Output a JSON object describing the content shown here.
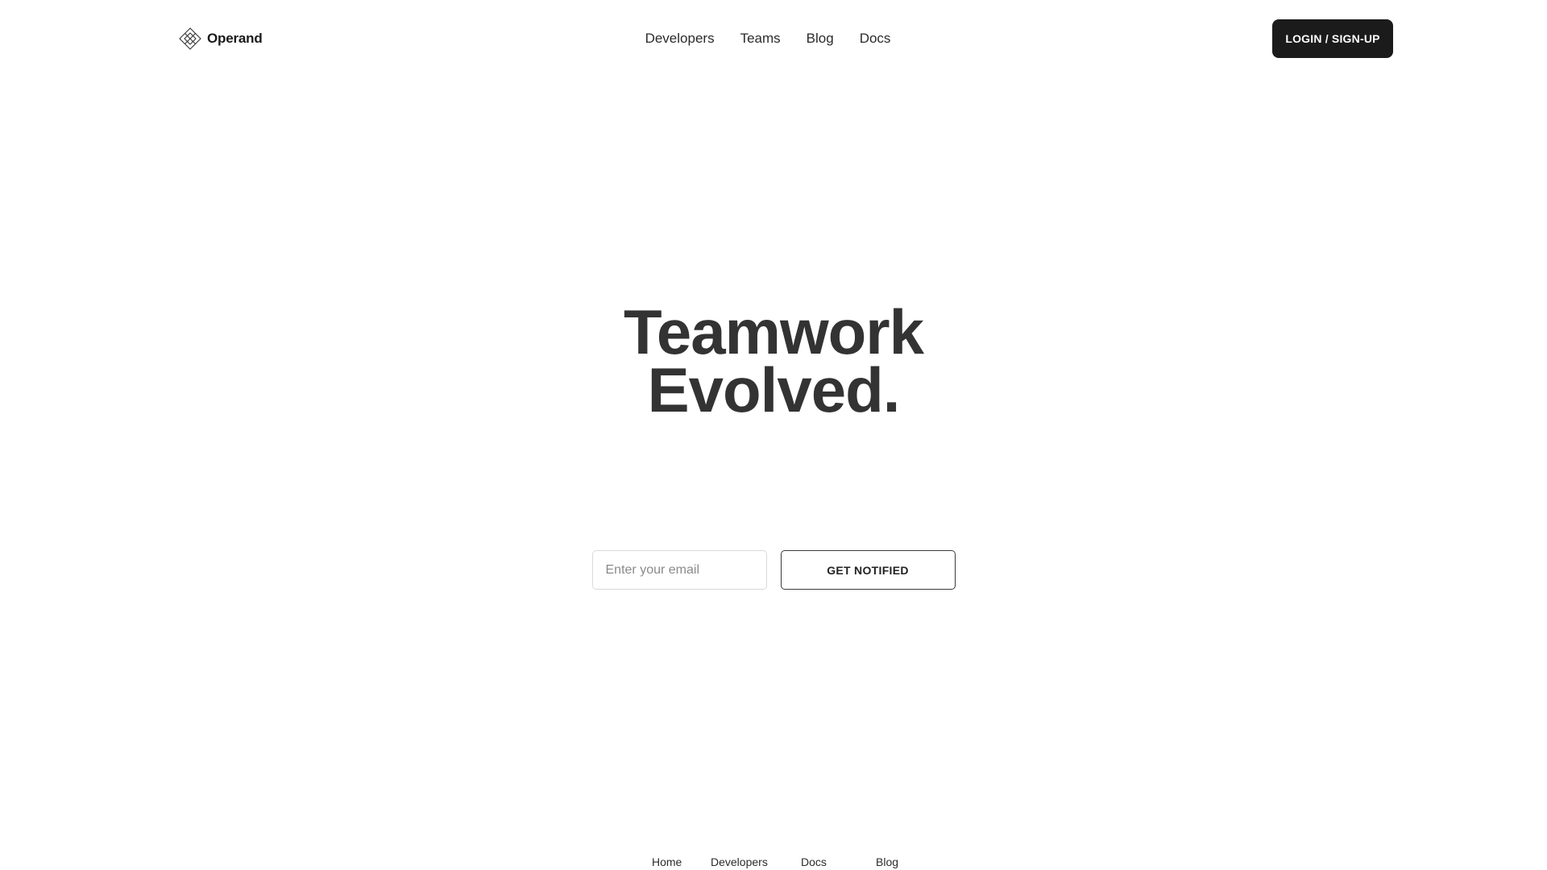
{
  "brand": {
    "name": "Operand",
    "icon": "diamond-grid-icon"
  },
  "nav": {
    "items": [
      "Developers",
      "Teams",
      "Blog",
      "Docs"
    ]
  },
  "header": {
    "login_label": "LOGIN / SIGN-UP"
  },
  "hero": {
    "line1": "Teamwork",
    "line2": "Evolved."
  },
  "signup": {
    "email_placeholder": "Enter your email",
    "email_value": "",
    "button_label": "GET NOTIFIED"
  },
  "footer": {
    "links": [
      "Home",
      "Developers",
      "Docs",
      "Blog"
    ]
  },
  "colors": {
    "text": "#333333",
    "button_dark": "#1b1b1b",
    "border_light": "#d9d9d9"
  }
}
